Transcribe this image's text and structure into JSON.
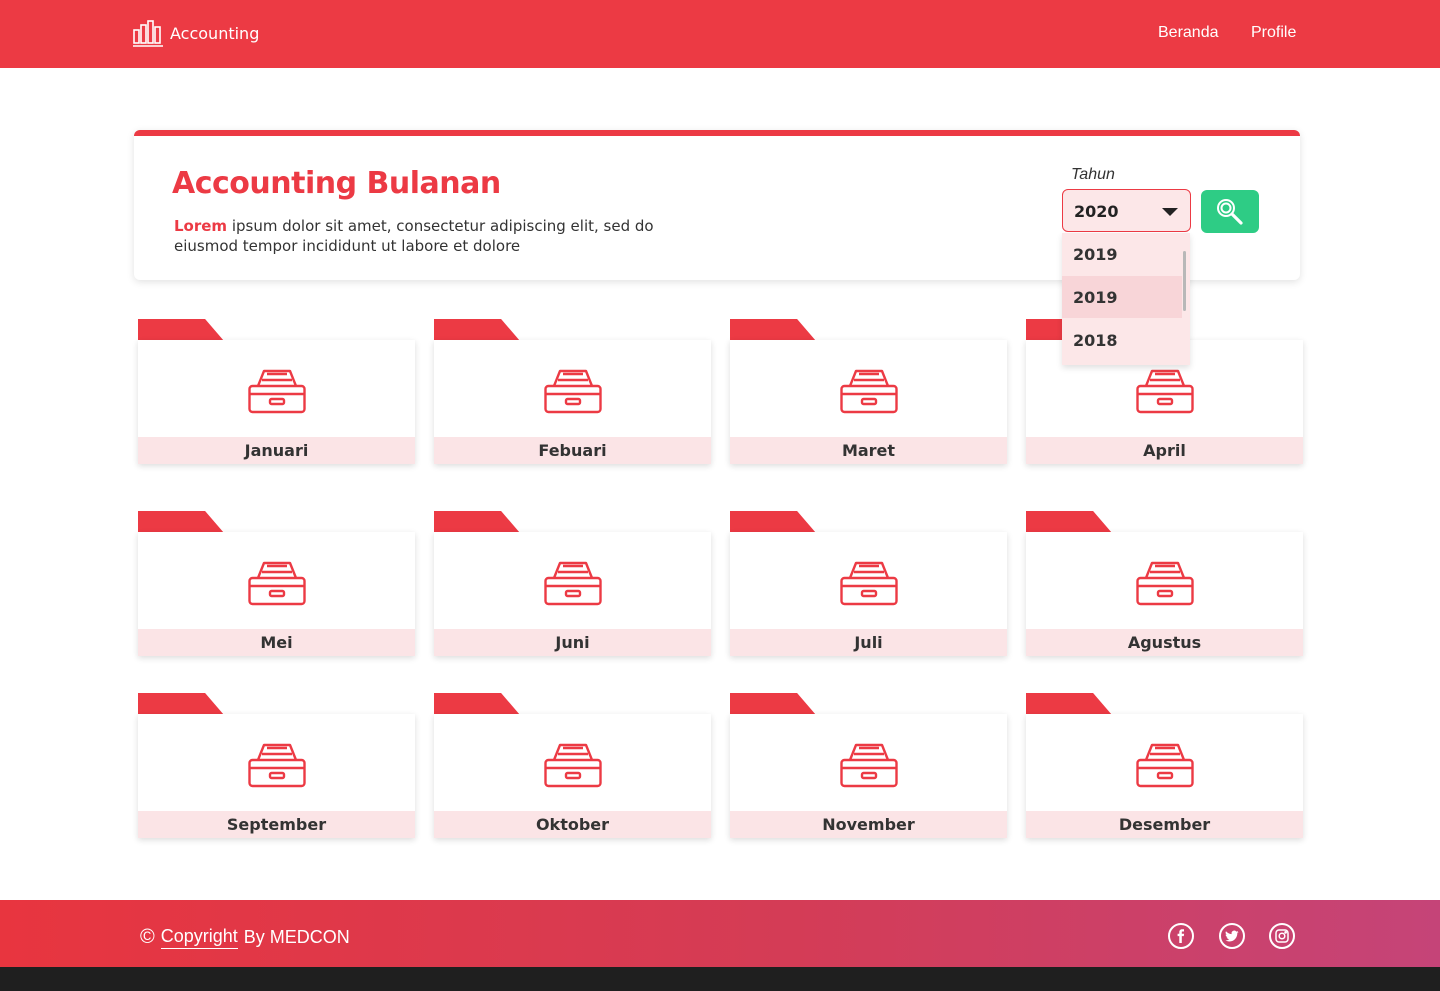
{
  "nav": {
    "brand": "Accounting",
    "links": [
      "Beranda",
      "Profile"
    ]
  },
  "header": {
    "title": "Accounting Bulanan",
    "desc_highlight": "Lorem",
    "desc_rest": " ipsum dolor sit amet, consectetur adipiscing elit, sed do eiusmod tempor incididunt ut labore et dolore",
    "year_label": "Tahun",
    "year_selected": "2020",
    "year_options": [
      "2019",
      "2019",
      "2018"
    ],
    "search_icon": "search-icon"
  },
  "months": [
    "Januari",
    "Febuari",
    "Maret",
    "April",
    "Mei",
    "Juni",
    "Juli",
    "Agustus",
    "September",
    "Oktober",
    "November",
    "Desember"
  ],
  "footer": {
    "copy_symbol": "©",
    "copy_link": "Copyright",
    "copy_rest": "By MEDCON",
    "social": [
      "facebook-icon",
      "twitter-icon",
      "instagram-icon"
    ]
  },
  "colors": {
    "accent": "#ec3a44",
    "accent_light": "#fbe4e6",
    "search_button": "#2ecc85",
    "footer_end": "#c54478"
  }
}
